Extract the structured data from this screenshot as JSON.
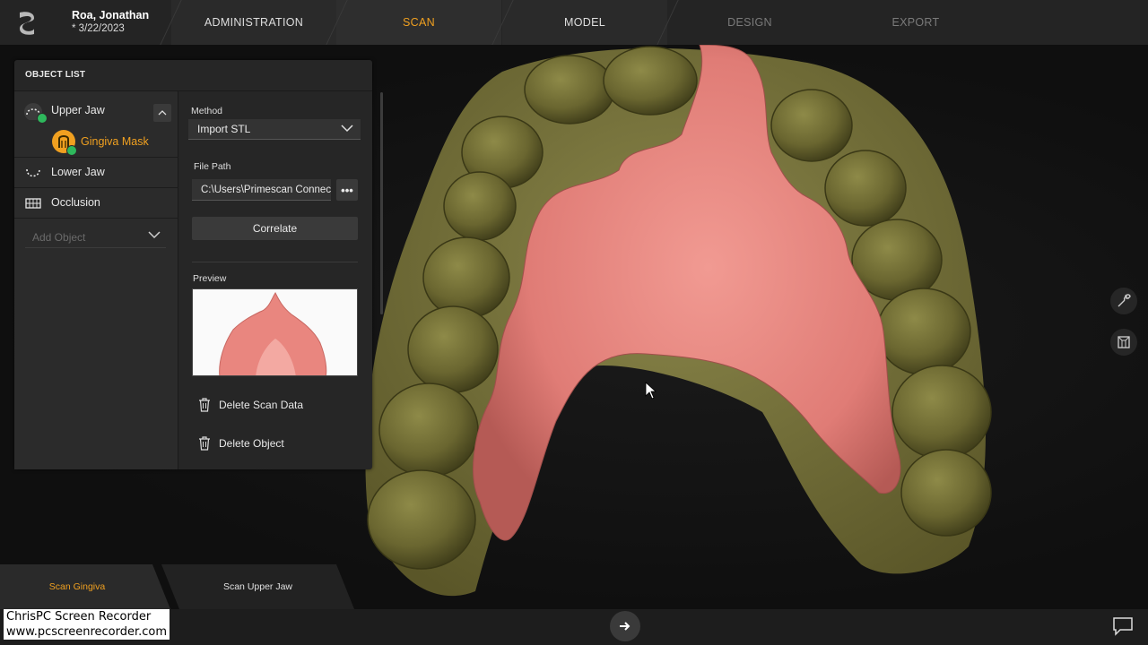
{
  "patient": {
    "name": "Roa, Jonathan",
    "date": "* 3/22/2023"
  },
  "tabs": [
    {
      "label": "ADMINISTRATION",
      "state": "enabled"
    },
    {
      "label": "SCAN",
      "state": "active"
    },
    {
      "label": "MODEL",
      "state": "enabled"
    },
    {
      "label": "DESIGN",
      "state": "disabled"
    },
    {
      "label": "EXPORT",
      "state": "disabled"
    }
  ],
  "panel": {
    "title": "OBJECT LIST",
    "objects": [
      {
        "label": "Upper Jaw",
        "icon": "upper-jaw-icon",
        "status": "complete"
      },
      {
        "label": "Gingiva Mask",
        "icon": "gingiva-mask-icon",
        "status": "complete",
        "selected": true
      },
      {
        "label": "Lower Jaw",
        "icon": "lower-jaw-icon"
      },
      {
        "label": "Occlusion",
        "icon": "occlusion-icon"
      }
    ],
    "add_object_placeholder": "Add Object",
    "method_label": "Method",
    "method_value": "Import STL",
    "filepath_label": "File Path",
    "filepath_value": "C:\\Users\\Primescan Connect",
    "browse_label": "•••",
    "correlate_label": "Correlate",
    "preview_label": "Preview",
    "delete_scan_label": "Delete Scan Data",
    "delete_object_label": "Delete Object"
  },
  "workflow": {
    "scan_gingiva": "Scan Gingiva",
    "scan_upper_jaw": "Scan Upper Jaw",
    "active": "Scan Gingiva"
  },
  "side_tools": [
    "wrench-icon",
    "view-cube-icon"
  ],
  "bottom": {
    "next_icon": "arrow-right-icon",
    "chat_icon": "chat-icon"
  },
  "watermark": {
    "line1": "ChrisPC Screen Recorder",
    "line2": "www.pcscreenrecorder.com"
  },
  "colors": {
    "accent": "#f0a020",
    "success": "#2eb85c",
    "gingiva": "#e8837e",
    "teeth": "#6e6a30"
  }
}
